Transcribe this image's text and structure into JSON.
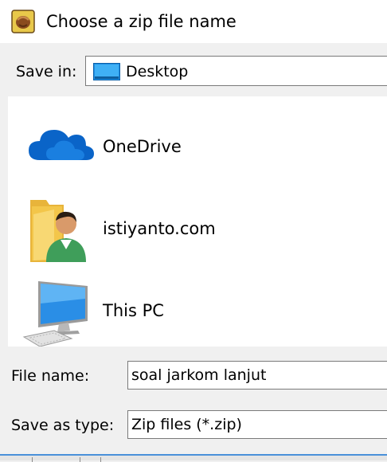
{
  "window": {
    "title": "Choose a zip file name",
    "app_icon": "winzip-icon"
  },
  "save_in": {
    "label": "Save in:",
    "value": "Desktop",
    "icon": "desktop-icon"
  },
  "places": [
    {
      "label": "OneDrive",
      "icon": "onedrive-cloud-icon"
    },
    {
      "label": "istiyanto.com",
      "icon": "user-folder-icon"
    },
    {
      "label": "This PC",
      "icon": "this-pc-icon"
    }
  ],
  "file_name": {
    "label": "File name:",
    "value": "soal jarkom lanjut"
  },
  "save_as_type": {
    "label": "Save as type:",
    "value": "Zip files (*.zip)"
  },
  "colors": {
    "onedrive_blue": "#0a64c8",
    "folder_yellow": "#f3c64a",
    "monitor_blue": "#2a8ee6"
  }
}
